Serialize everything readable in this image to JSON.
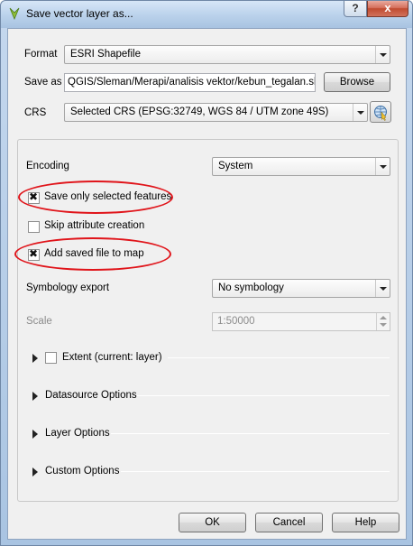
{
  "window": {
    "title": "Save vector layer as...",
    "help_label": "?",
    "close_label": "x"
  },
  "form": {
    "format_label": "Format",
    "format_value": "ESRI Shapefile",
    "saveas_label": "Save as",
    "saveas_value": "QGIS/Sleman/Merapi/analisis vektor/kebun_tegalan.shp",
    "browse_label": "Browse",
    "crs_label": "CRS",
    "crs_value": "Selected CRS (EPSG:32749, WGS 84 / UTM zone 49S)"
  },
  "options": {
    "encoding_label": "Encoding",
    "encoding_value": "System",
    "save_selected": {
      "label": "Save only selected features",
      "checked": true
    },
    "skip_attr": {
      "label": "Skip attribute creation",
      "checked": false
    },
    "add_to_map": {
      "label": "Add saved file to map",
      "checked": true
    },
    "symbology_label": "Symbology export",
    "symbology_value": "No symbology",
    "scale_label": "Scale",
    "scale_value": "1:50000",
    "extent_label": "Extent (current: layer)",
    "datasource_label": "Datasource Options",
    "layer_label": "Layer Options",
    "custom_label": "Custom Options"
  },
  "buttons": {
    "ok": "OK",
    "cancel": "Cancel",
    "help": "Help"
  },
  "colors": {
    "highlight": "#e0141a"
  }
}
